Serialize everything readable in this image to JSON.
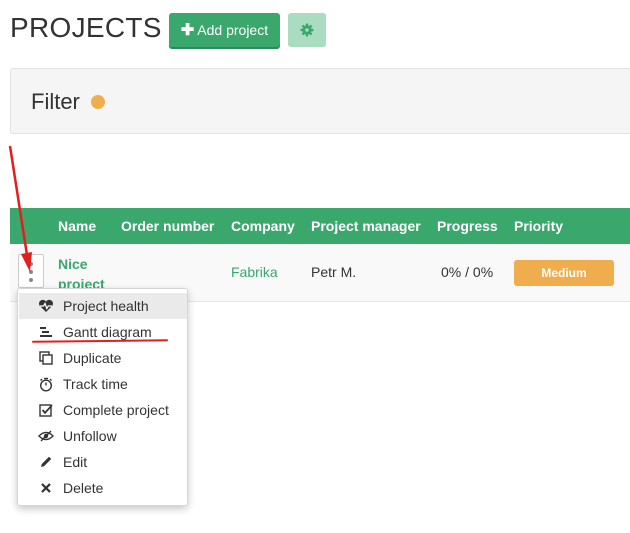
{
  "header": {
    "title": "PROJECTS",
    "add_button_label": "Add project",
    "add_button_icon": "plus-icon",
    "settings_button_icon": "gear-icon"
  },
  "filter": {
    "label": "Filter",
    "indicator_color": "#f0ad4e"
  },
  "table": {
    "columns": [
      "Name",
      "Order number",
      "Company",
      "Project manager",
      "Progress",
      "Priority"
    ],
    "rows": [
      {
        "name": "Nice project",
        "order_number": "",
        "company": "Fabrika",
        "project_manager": "Petr M.",
        "progress": "0% / 0%",
        "priority": "Medium"
      }
    ]
  },
  "context_menu": {
    "items": [
      {
        "label": "Project health",
        "icon": "heart-pulse-icon"
      },
      {
        "label": "Gantt diagram",
        "icon": "gantt-icon"
      },
      {
        "label": "Duplicate",
        "icon": "duplicate-icon"
      },
      {
        "label": "Track time",
        "icon": "stopwatch-icon"
      },
      {
        "label": "Complete project",
        "icon": "checkbox-icon"
      },
      {
        "label": "Unfollow",
        "icon": "eye-slash-icon"
      },
      {
        "label": "Edit",
        "icon": "pencil-icon"
      },
      {
        "label": "Delete",
        "icon": "close-icon"
      }
    ]
  },
  "annotation": {
    "color": "#e0201e"
  },
  "colors": {
    "accent_green": "#3aa76d",
    "light_green": "#a9dcc0",
    "priority_medium": "#f0ad4e"
  }
}
